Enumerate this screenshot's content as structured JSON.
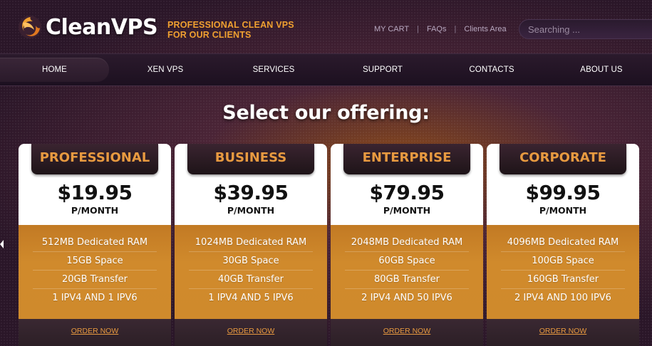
{
  "brand": {
    "name": "CleanVPS",
    "tagline_line1": "PROFESSIONAL CLEAN VPS",
    "tagline_line2": "FOR OUR CLIENTS"
  },
  "toplinks": [
    "MY CART",
    "FAQs",
    "Clients Area"
  ],
  "search": {
    "placeholder": "Searching ..."
  },
  "nav": [
    "HOME",
    "XEN VPS",
    "SERVICES",
    "SUPPORT",
    "CONTACTS",
    "ABOUT US"
  ],
  "nav_active": "HOME",
  "hero": {
    "title": "Select our offering:"
  },
  "plans": [
    {
      "name": "PROFESSIONAL",
      "price": "$19.95",
      "period": "P/MONTH",
      "features": [
        "512MB Dedicated RAM",
        "15GB Space",
        "20GB Transfer",
        "1 IPV4 AND 1 IPV6"
      ],
      "cta": "ORDER NOW"
    },
    {
      "name": "BUSINESS",
      "price": "$39.95",
      "period": "P/MONTH",
      "features": [
        "1024MB Dedicated RAM",
        "30GB Space",
        "40GB Transfer",
        "1 IPV4 AND 5 IPV6"
      ],
      "cta": "ORDER NOW"
    },
    {
      "name": "ENTERPRISE",
      "price": "$79.95",
      "period": "P/MONTH",
      "features": [
        "2048MB Dedicated RAM",
        "60GB Space",
        "80GB Transfer",
        "2 IPV4 AND 50 IPV6"
      ],
      "cta": "ORDER NOW"
    },
    {
      "name": "CORPORATE",
      "price": "$99.95",
      "period": "P/MONTH",
      "features": [
        "4096MB Dedicated RAM",
        "100GB Space",
        "160GB Transfer",
        "2 IPV4 AND 100 IPV6"
      ],
      "cta": "ORDER NOW"
    }
  ],
  "colors": {
    "accent": "#e89a40",
    "tagline": "#f0a030",
    "feature_bg": "#cf8a2c"
  }
}
